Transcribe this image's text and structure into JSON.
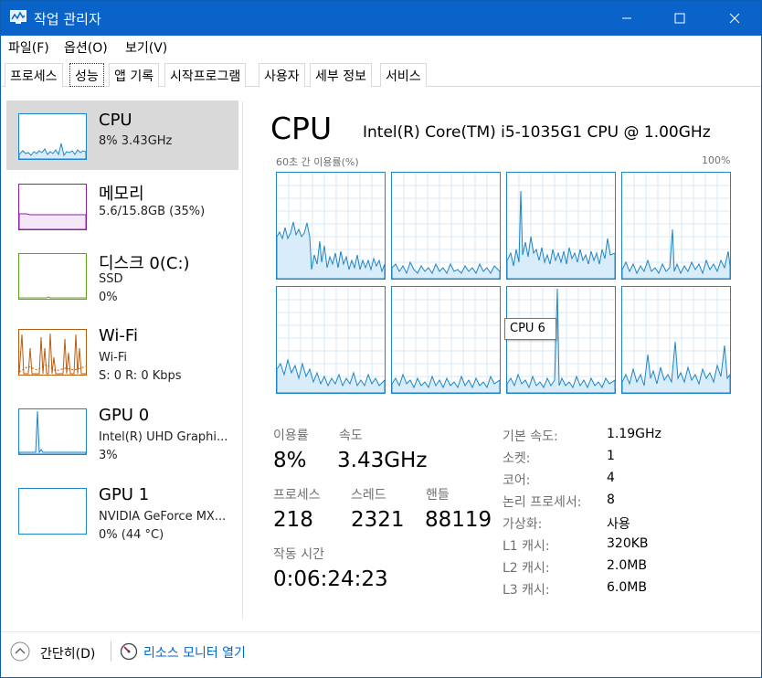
{
  "window": {
    "title": "작업 관리자",
    "colors": {
      "titlebar": "#0a63c9",
      "accent_cpu": "#1e85c7",
      "memory": "#8b1fa9",
      "disk": "#5aa617",
      "wifi": "#b65c10"
    }
  },
  "menu": [
    {
      "label": "파일(F)",
      "icon": ""
    },
    {
      "label": "옵션(O)",
      "icon": ""
    },
    {
      "label": "보기(V)",
      "icon": ""
    }
  ],
  "tabs": [
    {
      "label": "프로세스"
    },
    {
      "label": "성능"
    },
    {
      "label": "앱 기록"
    },
    {
      "label": "시작프로그램"
    },
    {
      "label": "사용자"
    },
    {
      "label": "세부 정보"
    },
    {
      "label": "서비스"
    }
  ],
  "active_tab": "성능",
  "sidebar": {
    "items": [
      {
        "name": "CPU",
        "line1": "8% 3.43GHz",
        "line2": "",
        "line3": ""
      },
      {
        "name": "메모리",
        "line1": "5.6/15.8GB (35%)",
        "line2": "",
        "line3": ""
      },
      {
        "name": "디스크 0(C:)",
        "line1": "SSD",
        "line2": "0%",
        "line3": ""
      },
      {
        "name": "Wi-Fi",
        "line1": "Wi-Fi",
        "line2": "S: 0 R: 0 Kbps",
        "line3": ""
      },
      {
        "name": "GPU 0",
        "line1": "Intel(R) UHD Graphi...",
        "line2": "3%",
        "line3": ""
      },
      {
        "name": "GPU 1",
        "line1": "NVIDIA GeForce MX...",
        "line2": "0% (44 °C)",
        "line3": ""
      }
    ]
  },
  "main": {
    "title": "CPU",
    "model": "Intel(R) Core(TM) i5-1035G1 CPU @ 1.00GHz",
    "graph_left_label": "60초 간 이용률(%)",
    "graph_right_label": "100%",
    "tooltip": "CPU 6",
    "stats": {
      "utilization_label": "이용률",
      "utilization": "8%",
      "speed_label": "속도",
      "speed": "3.43GHz",
      "processes_label": "프로세스",
      "processes": "218",
      "threads_label": "스레드",
      "threads": "2321",
      "handles_label": "핸들",
      "handles": "88119",
      "uptime_label": "작동 시간",
      "uptime": "0:06:24:23"
    },
    "properties": [
      {
        "label": "기본 속도:",
        "value": "1.19GHz"
      },
      {
        "label": "소켓:",
        "value": "1"
      },
      {
        "label": "코어:",
        "value": "4"
      },
      {
        "label": "논리 프로세서:",
        "value": "8"
      },
      {
        "label": "가상화:",
        "value": "사용"
      },
      {
        "label": "L1 캐시:",
        "value": "320KB"
      },
      {
        "label": "L2 캐시:",
        "value": "2.0MB"
      },
      {
        "label": "L3 캐시:",
        "value": "6.0MB"
      }
    ]
  },
  "footer": {
    "fewer_details": "간단히(D)",
    "resource_monitor": "리소스 모니터 열기"
  }
}
